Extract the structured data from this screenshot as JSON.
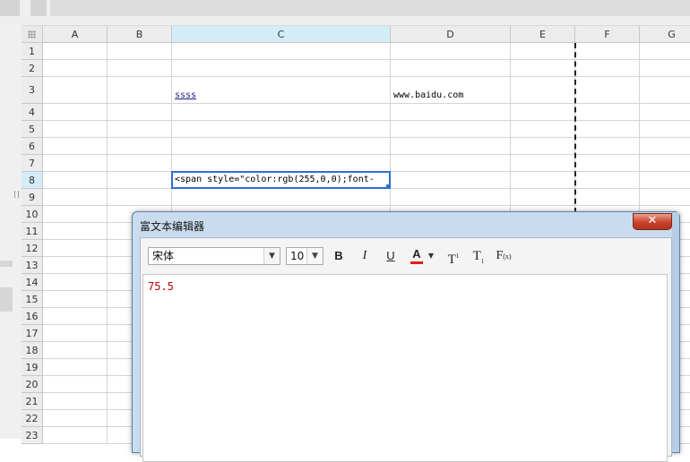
{
  "spreadsheet": {
    "columns": [
      "A",
      "B",
      "C",
      "D",
      "E",
      "F",
      "G"
    ],
    "rows": [
      "1",
      "2",
      "3",
      "4",
      "5",
      "6",
      "7",
      "8",
      "9",
      "10",
      "11",
      "12",
      "13",
      "14",
      "15",
      "16",
      "17",
      "18",
      "19",
      "20",
      "21",
      "22",
      "23"
    ],
    "selected_column": "C",
    "selected_row": "8",
    "cells": {
      "C3": "ssss",
      "D3": "www.baidu.com",
      "C8": "<span style=\"color:rgb(255,0,0);font-"
    }
  },
  "dialog": {
    "title": "富文本编辑器",
    "close_label": "✕",
    "font_name": "宋体",
    "font_size": "10",
    "bold_label": "B",
    "italic_label": "I",
    "underline_label": "U",
    "color_label": "A",
    "superscript_label": "T",
    "superscript_mark": "1",
    "subscript_label": "T",
    "subscript_mark": "1",
    "formula_label": "F",
    "formula_mark": "(x)",
    "content": "75.5",
    "content_color": "#c00000",
    "font_color_swatch": "#e02020"
  },
  "icons": {
    "dropdown": "chevron-down-icon",
    "color_dropdown": "caret-down-icon"
  }
}
